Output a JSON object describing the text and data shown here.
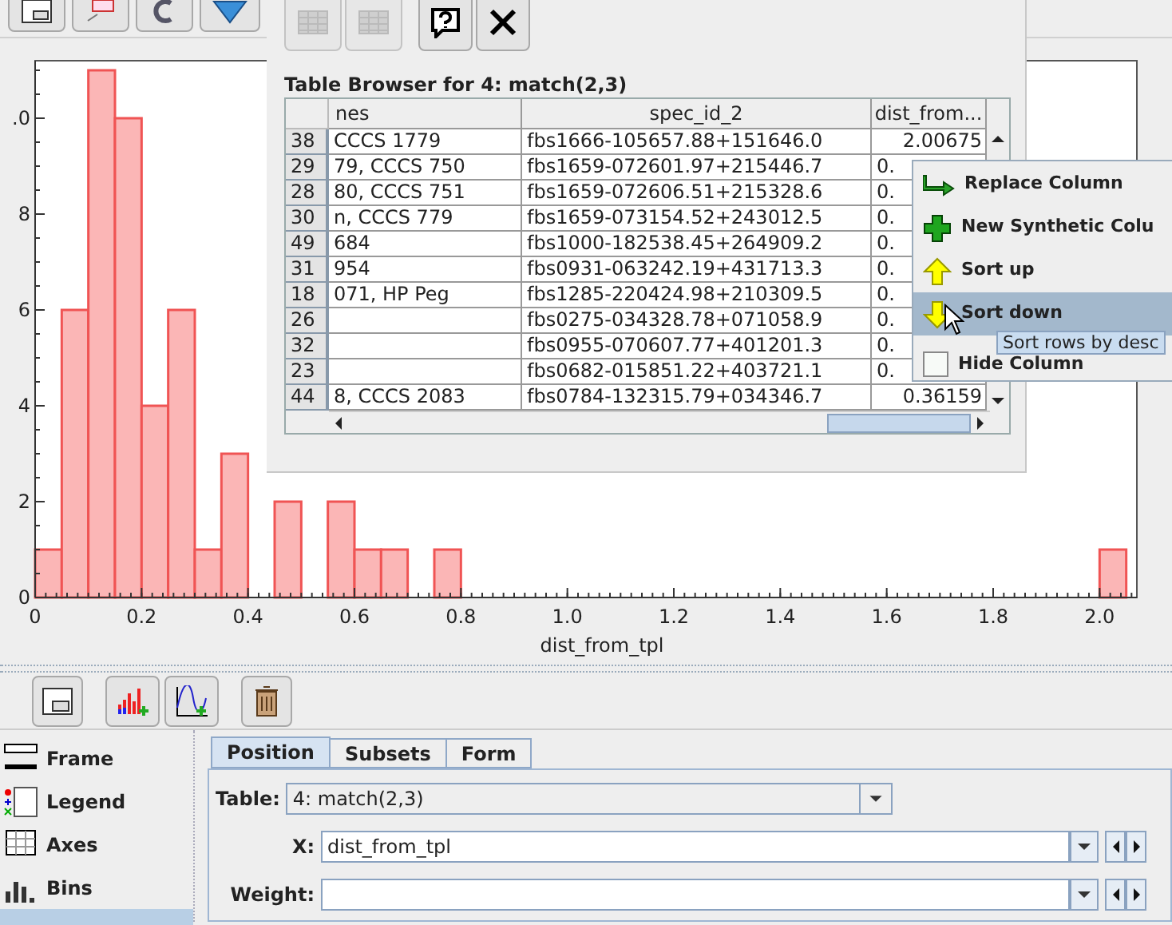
{
  "plot": {
    "cut_tick_label": ".0",
    "chart_data": {
      "type": "bar",
      "xlabel": "dist_from_tpl",
      "x": [
        0.025,
        0.075,
        0.125,
        0.175,
        0.225,
        0.275,
        0.325,
        0.375,
        0.475,
        0.575,
        0.625,
        0.675,
        0.775,
        2.025
      ],
      "values": [
        1,
        6,
        11,
        10,
        4,
        6,
        1,
        3,
        2,
        2,
        1,
        1,
        1,
        1
      ],
      "xlim": [
        0,
        2.07
      ],
      "ylim": [
        0,
        11.2
      ],
      "xticks": [
        0,
        0.2,
        0.4,
        0.6,
        0.8,
        {
          "value": 1,
          "label": "1.0"
        },
        1.2,
        1.4,
        1.6,
        1.8,
        {
          "value": 2,
          "label": "2.0"
        }
      ],
      "yticks": [
        0,
        2,
        4,
        6,
        8
      ]
    }
  },
  "table_browser": {
    "title": "Table Browser for 4: match(2,3)",
    "columns": [
      "nes",
      "spec_id_2",
      "dist_from..."
    ],
    "rows": [
      {
        "index": "38",
        "name": "CCCS 1779",
        "spec_id_2": "fbs1666-105657.88+151646.0",
        "dist": "2.00675"
      },
      {
        "index": "29",
        "name": "79, CCCS 750",
        "spec_id_2": "fbs1659-072601.97+215446.7",
        "dist": "0."
      },
      {
        "index": "28",
        "name": "80, CCCS 751",
        "spec_id_2": "fbs1659-072606.51+215328.6",
        "dist": "0."
      },
      {
        "index": "30",
        "name": "n, CCCS 779",
        "spec_id_2": "fbs1659-073154.52+243012.5",
        "dist": "0."
      },
      {
        "index": "49",
        "name": "684",
        "spec_id_2": "fbs1000-182538.45+264909.2",
        "dist": "0."
      },
      {
        "index": "31",
        "name": "954",
        "spec_id_2": "fbs0931-063242.19+431713.3",
        "dist": "0."
      },
      {
        "index": "18",
        "name": "071, HP Peg",
        "spec_id_2": "fbs1285-220424.98+210309.5",
        "dist": "0."
      },
      {
        "index": "26",
        "spec_id_2": "fbs0275-034328.78+071058.9",
        "dist": "0."
      },
      {
        "index": "32",
        "spec_id_2": "fbs0955-070607.77+401201.3",
        "dist": "0."
      },
      {
        "index": "23",
        "spec_id_2": "fbs0682-015851.22+403721.1",
        "dist": "0."
      },
      {
        "index": "44",
        "name": "8, CCCS 2083",
        "spec_id_2": "fbs0784-132315.79+034346.7",
        "dist": "0.36159"
      }
    ]
  },
  "context_menu": {
    "items": [
      {
        "kind": "replace",
        "label": "Replace Column",
        "selected": false
      },
      {
        "kind": "add",
        "label": "New Synthetic Colu",
        "selected": false
      },
      {
        "kind": "up",
        "label": "Sort up",
        "selected": false
      },
      {
        "kind": "down",
        "label": "Sort down",
        "selected": true
      },
      {
        "kind": "checkbox",
        "label": "Hide Column",
        "checked": false,
        "selected": false
      }
    ]
  },
  "tooltip": "Sort rows by desc",
  "plot_items": [
    {
      "kind": "frame",
      "label": "Frame",
      "selected": false
    },
    {
      "kind": "legend",
      "label": "Legend",
      "selected": false
    },
    {
      "kind": "axes",
      "label": "Axes",
      "selected": false
    },
    {
      "kind": "bins",
      "label": "Bins",
      "selected": false
    },
    {
      "kind": "layer",
      "selected": true
    }
  ],
  "tabs": [
    {
      "label": "Position",
      "selected": true
    },
    {
      "label": "Subsets",
      "selected": false
    },
    {
      "label": "Form",
      "selected": false
    }
  ],
  "form": {
    "table": {
      "label": "Table:",
      "value": "4: match(2,3)"
    },
    "x": {
      "label": "X:",
      "value": "dist_from_tpl"
    },
    "weight": {
      "label": "Weight:"
    }
  }
}
